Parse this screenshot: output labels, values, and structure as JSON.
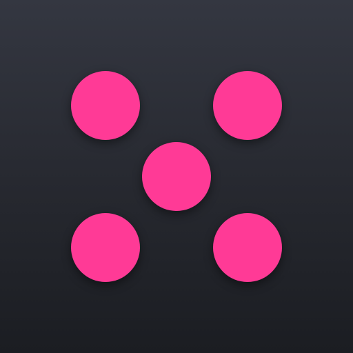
{
  "app_icon": {
    "icon": "dice-five-icon",
    "pip_count": 5,
    "colors": {
      "pip": "#ff3a96",
      "background_top": "#343741",
      "background_bottom": "#1b1d22"
    }
  }
}
